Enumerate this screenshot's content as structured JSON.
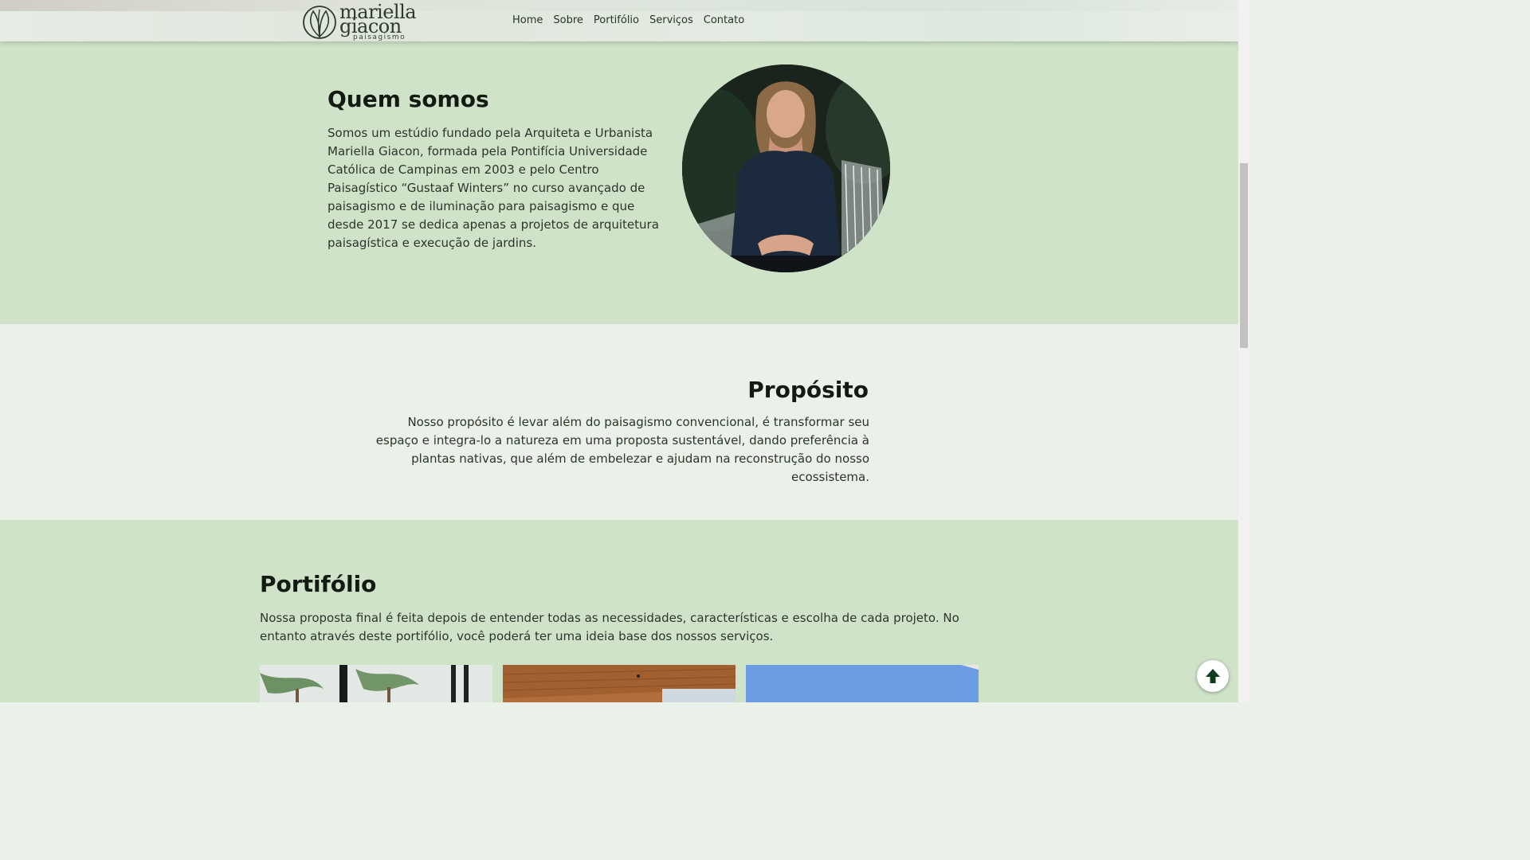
{
  "header": {
    "logo": {
      "line1": "mariella",
      "line2": "giacon",
      "line3": "paisagismo"
    },
    "nav": [
      "Home",
      "Sobre",
      "Portifólio",
      "Serviços",
      "Contato"
    ]
  },
  "quem_somos": {
    "title": "Quem somos",
    "text": "Somos um estúdio fundado pela Arquiteta e Urbanista Mariella Giacon, formada pela Pontifícia Universidade Católica de Campinas em 2003 e pelo Centro Paisagístico “Gustaaf Winters” no curso avançado de paisagismo e de iluminação para paisagismo e que desde 2017 se dedica apenas a projetos de arquitetura paisagística e execução de jardins."
  },
  "proposito": {
    "title": "Propósito",
    "text": "Nosso propósito é levar além do paisagismo convencional, é transformar seu espaço e integra-lo a natureza em uma proposta sustentável, dando preferência à plantas nativas, que além de embelezar e ajudam na reconstrução do nosso ecossistema."
  },
  "portfolio": {
    "title": "Portifólio",
    "text": "Nossa proposta final é feita depois de entender todas as necessidades, características e escolha de cada projeto. No entanto através deste portifólio, você poderá ter uma ideia base dos nossos serviços."
  },
  "icons": {
    "logo_mark": "leaf-circle-icon",
    "back_to_top": "arrow-up-icon"
  },
  "colors": {
    "section_green": "#cfe3c9",
    "section_light": "#eaf1e8",
    "heading": "#121a12",
    "accent_dark_green": "#0f3d1c"
  }
}
